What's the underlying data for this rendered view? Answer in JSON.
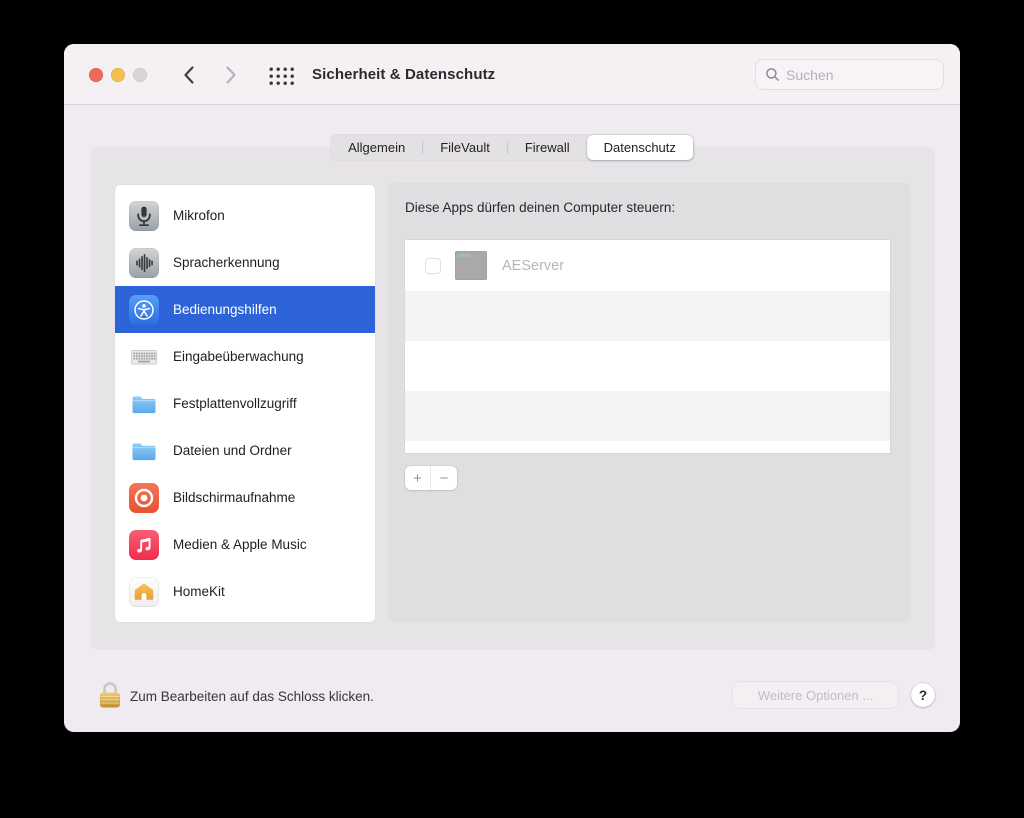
{
  "window": {
    "title": "Sicherheit & Datenschutz"
  },
  "toolbar": {
    "search_placeholder": "Suchen"
  },
  "tabs": [
    {
      "label": "Allgemein",
      "selected": false
    },
    {
      "label": "FileVault",
      "selected": false
    },
    {
      "label": "Firewall",
      "selected": false
    },
    {
      "label": "Datenschutz",
      "selected": true
    }
  ],
  "sidebar": {
    "items": [
      {
        "label": "Mikrofon",
        "icon": "microphone-icon",
        "selected": false
      },
      {
        "label": "Spracherkennung",
        "icon": "speech-recognition-icon",
        "selected": false
      },
      {
        "label": "Bedienungshilfen",
        "icon": "accessibility-icon",
        "selected": true
      },
      {
        "label": "Eingabeüberwachung",
        "icon": "keyboard-icon",
        "selected": false
      },
      {
        "label": "Festplattenvollzugriff",
        "icon": "folder-icon",
        "selected": false
      },
      {
        "label": "Dateien und Ordner",
        "icon": "folder-icon",
        "selected": false
      },
      {
        "label": "Bildschirmaufnahme",
        "icon": "screen-recording-icon",
        "selected": false
      },
      {
        "label": "Medien & Apple Music",
        "icon": "music-icon",
        "selected": false
      },
      {
        "label": "HomeKit",
        "icon": "homekit-icon",
        "selected": false
      }
    ]
  },
  "privacy": {
    "heading": "Diese Apps dürfen deinen Computer steuern:",
    "apps": [
      {
        "name": "AEServer",
        "checked": false,
        "enabled": false,
        "icon": "exec-app-icon",
        "icon_badge": "exec"
      }
    ],
    "add_button_label": "+",
    "remove_button_label": "−"
  },
  "footer": {
    "lock_text": "Zum Bearbeiten auf das Schloss klicken.",
    "lock_state": "locked",
    "more_options_label": "Weitere Optionen ...",
    "help_label": "?"
  },
  "colors": {
    "selection_blue": "#2c64d8",
    "traffic_red": "#ee6a5f",
    "traffic_yellow": "#f5bf4e",
    "traffic_inactive": "#d8d4d8",
    "panel_grey": "#e7e4e8",
    "detail_grey": "#e1dee2"
  }
}
